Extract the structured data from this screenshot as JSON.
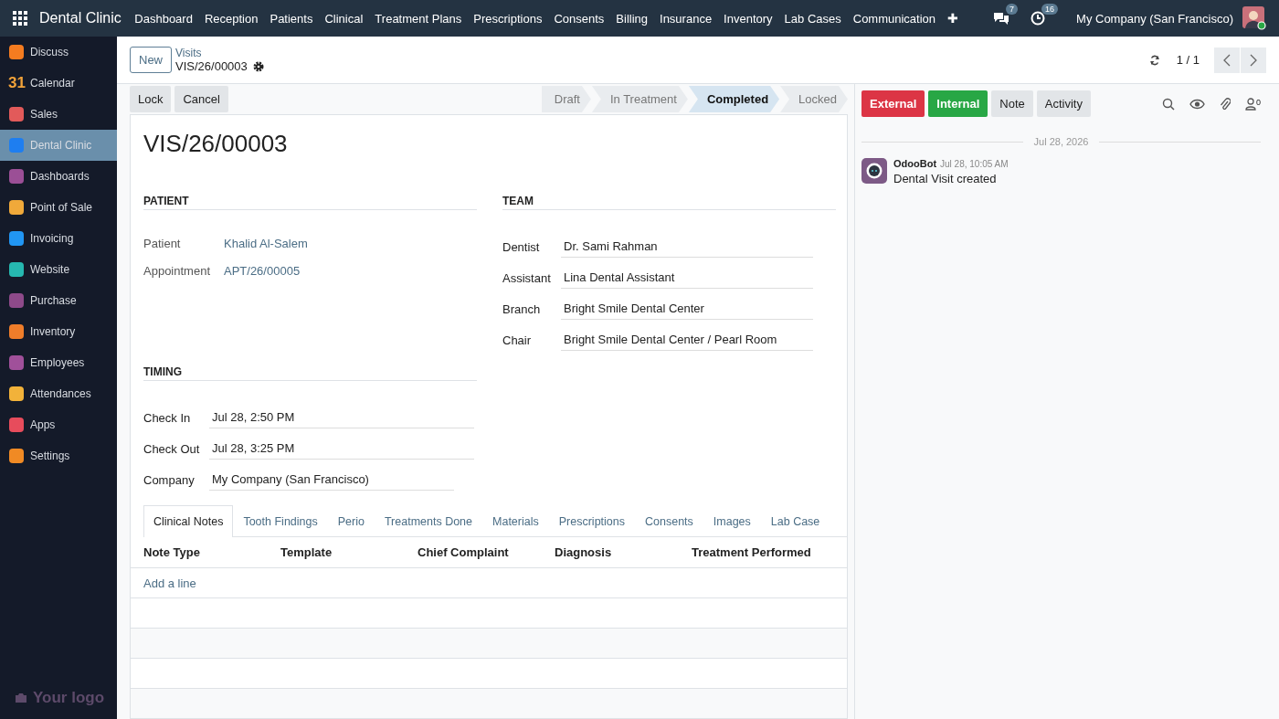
{
  "topbar": {
    "app_name": "Dental Clinic",
    "menu": [
      "Dashboard",
      "Reception",
      "Patients",
      "Clinical",
      "Treatment Plans",
      "Prescriptions",
      "Consents",
      "Billing",
      "Insurance",
      "Inventory",
      "Lab Cases",
      "Communication"
    ],
    "plus": "✚",
    "messages_count": "7",
    "activities_count": "16",
    "company": "My Company (San Francisco)"
  },
  "sidebar": {
    "items": [
      {
        "label": "Discuss",
        "selected": false,
        "color": "#f57c20"
      },
      {
        "label": "Calendar",
        "selected": false,
        "color": "#f2a33a",
        "icon_text": "31"
      },
      {
        "label": "Sales",
        "selected": false,
        "color": "#e25a5a"
      },
      {
        "label": "Dental Clinic",
        "selected": true,
        "color": "#1e7ef0"
      },
      {
        "label": "Dashboards",
        "selected": false,
        "color": "#9b4f96"
      },
      {
        "label": "Point of Sale",
        "selected": false,
        "color": "#f0a93a"
      },
      {
        "label": "Invoicing",
        "selected": false,
        "color": "#2196f3"
      },
      {
        "label": "Website",
        "selected": false,
        "color": "#26b8b0"
      },
      {
        "label": "Purchase",
        "selected": false,
        "color": "#8e4a8a"
      },
      {
        "label": "Inventory",
        "selected": false,
        "color": "#ef7d2a"
      },
      {
        "label": "Employees",
        "selected": false,
        "color": "#a0509a"
      },
      {
        "label": "Attendances",
        "selected": false,
        "color": "#f2b23a"
      },
      {
        "label": "Apps",
        "selected": false,
        "color": "#e74c5c"
      },
      {
        "label": "Settings",
        "selected": false,
        "color": "#f08a24"
      }
    ],
    "logo": "Your logo"
  },
  "control_panel": {
    "new_button": "New",
    "breadcrumb": "Visits",
    "record": "VIS/26/00003",
    "pager": "1 / 1"
  },
  "actions": [
    "Lock",
    "Cancel"
  ],
  "statusbar": [
    {
      "label": "Draft",
      "selected": false
    },
    {
      "label": "In Treatment",
      "selected": false
    },
    {
      "label": "Completed",
      "selected": true
    },
    {
      "label": "Locked",
      "selected": false
    }
  ],
  "chatter": {
    "buttons": [
      {
        "label": "External",
        "kind": "danger"
      },
      {
        "label": "Internal",
        "kind": "success"
      },
      {
        "label": "Note",
        "kind": "plain"
      },
      {
        "label": "Activity",
        "kind": "plain"
      }
    ],
    "followers_count": "0",
    "date_separator": "Jul 28, 2026",
    "messages": [
      {
        "author": "OdooBot",
        "time": "Jul 28, 10:05 AM",
        "body": "Dental Visit created"
      }
    ]
  },
  "form": {
    "title": "VIS/26/00003",
    "groups": [
      {
        "title": "PATIENT",
        "fields": [
          {
            "label": "Patient",
            "value": "Khalid Al-Salem",
            "kind": "link"
          },
          {
            "label": "Appointment",
            "value": "APT/26/00005",
            "kind": "link"
          }
        ]
      },
      {
        "title": "TEAM",
        "fields": [
          {
            "label": "Dentist",
            "value": "Dr. Sami Rahman",
            "kind": "input"
          },
          {
            "label": "Assistant",
            "value": "Lina Dental Assistant",
            "kind": "input"
          },
          {
            "label": "Branch",
            "value": "Bright Smile Dental Center",
            "kind": "input"
          },
          {
            "label": "Chair",
            "value": "Bright Smile Dental Center / Pearl Room",
            "kind": "input"
          }
        ]
      },
      {
        "title": "TIMING",
        "fields": [
          {
            "label": "Check In",
            "value": "Jul 28, 2:50 PM",
            "kind": "input"
          },
          {
            "label": "Check Out",
            "value": "Jul 28, 3:25 PM",
            "kind": "input"
          },
          {
            "label": "Company",
            "value": "My Company (San Francisco)",
            "kind": "input"
          }
        ]
      }
    ],
    "tabs": [
      {
        "label": "Clinical Notes",
        "selected": true
      },
      {
        "label": "Tooth Findings",
        "selected": false
      },
      {
        "label": "Perio",
        "selected": false
      },
      {
        "label": "Treatments Done",
        "selected": false
      },
      {
        "label": "Materials",
        "selected": false
      },
      {
        "label": "Prescriptions",
        "selected": false
      },
      {
        "label": "Consents",
        "selected": false
      },
      {
        "label": "Images",
        "selected": false
      },
      {
        "label": "Lab Case",
        "selected": false
      }
    ],
    "table": {
      "columns": [
        "Note Type",
        "Template",
        "Chief Complaint",
        "Diagnosis",
        "Treatment Performed"
      ],
      "add_line": "Add a line"
    }
  }
}
